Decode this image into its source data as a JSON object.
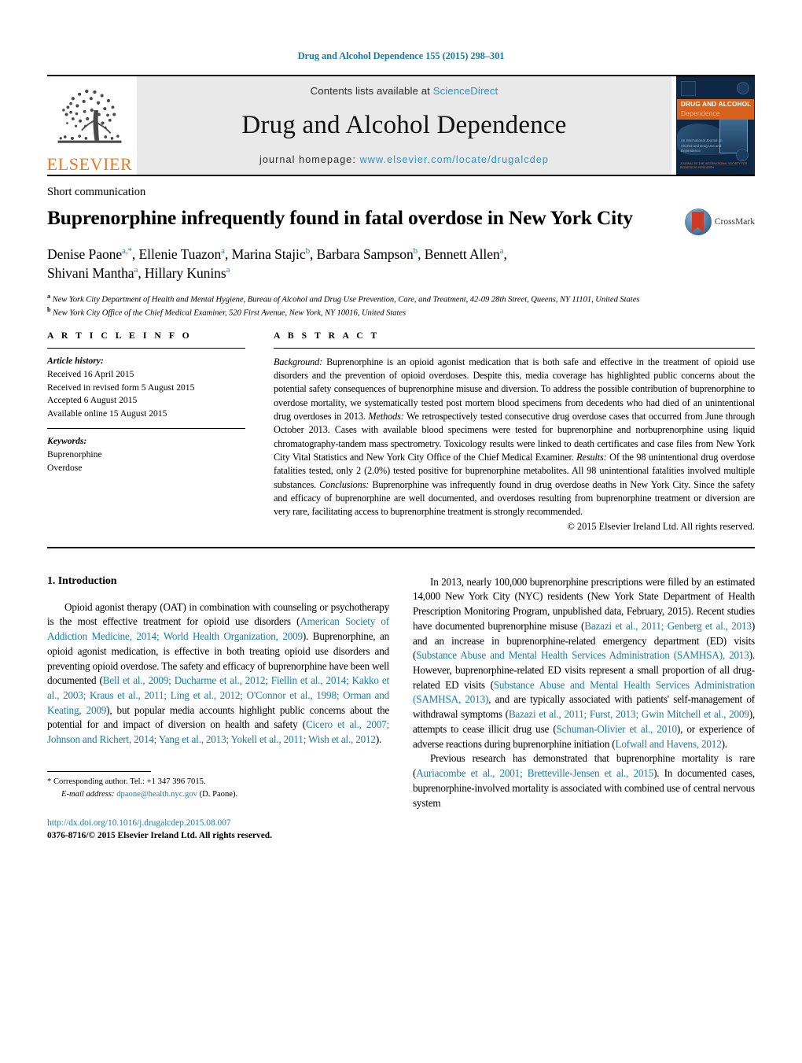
{
  "running_head": "Drug and Alcohol Dependence 155 (2015) 298–301",
  "banner": {
    "contents_prefix": "Contents lists available at ",
    "sciencedirect": "ScienceDirect",
    "journal_name": "Drug and Alcohol Dependence",
    "homepage_prefix": "journal homepage: ",
    "homepage_url": "www.elsevier.com/locate/drugalcdep",
    "publisher_wordmark": "ELSEVIER",
    "cover": {
      "title_line1": "DRUG AND ALCOHOL",
      "title_line2": "Dependence",
      "small_text": "An International Journal on Alcohol and Drug Use and Dependence",
      "bottom_text": "JOURNAL OF THE INTERNATIONAL SOCIETY FOR BIOMEDICAL RESEARCH"
    },
    "accent_orange": "#E87722",
    "accent_link": "#2b93c7"
  },
  "article": {
    "type": "Short communication",
    "title": "Buprenorphine infrequently found in fatal overdose in New York City",
    "crossmark_label": "CrossMark",
    "authors_line1_parts": [
      {
        "name": "Denise Paone",
        "sup": "a,*"
      },
      {
        "name": "Ellenie Tuazon",
        "sup": "a"
      },
      {
        "name": "Marina Stajic",
        "sup": "b"
      },
      {
        "name": "Barbara Sampson",
        "sup": "b"
      },
      {
        "name": "Bennett Allen",
        "sup": "a"
      }
    ],
    "authors_line2_parts": [
      {
        "name": "Shivani Mantha",
        "sup": "a"
      },
      {
        "name": "Hillary Kunins",
        "sup": "a"
      }
    ],
    "affiliation_a_marker": "a",
    "affiliation_a": "New York City Department of Health and Mental Hygiene, Bureau of Alcohol and Drug Use Prevention, Care, and Treatment, 42-09 28th Street, Queens, NY 11101, United States",
    "affiliation_b_marker": "b",
    "affiliation_b": "New York City Office of the Chief Medical Examiner, 520 First Avenue, New York, NY 10016, United States"
  },
  "article_info": {
    "heading": "A R T I C L E    I N F O",
    "history_label": "Article history:",
    "history": [
      "Received 16 April 2015",
      "Received in revised form 5 August 2015",
      "Accepted 6 August 2015",
      "Available online 15 August 2015"
    ],
    "keywords_label": "Keywords:",
    "keywords": [
      "Buprenorphine",
      "Overdose"
    ]
  },
  "abstract": {
    "heading": "A B S T R A C T",
    "sections": [
      {
        "label": "Background:",
        "text": " Buprenorphine is an opioid agonist medication that is both safe and effective in the treatment of opioid use disorders and the prevention of opioid overdoses. Despite this, media coverage has highlighted public concerns about the potential safety consequences of buprenorphine misuse and diversion. To address the possible contribution of buprenorphine to overdose mortality, we systematically tested post mortem blood specimens from decedents who had died of an unintentional drug overdoses in 2013."
      },
      {
        "label": "Methods:",
        "text": " We retrospectively tested consecutive drug overdose cases that occurred from June through October 2013. Cases with available blood specimens were tested for buprenorphine and norbuprenorphine using liquid chromatography-tandem mass spectrometry. Toxicology results were linked to death certificates and case files from New York City Vital Statistics and New York City Office of the Chief Medical Examiner."
      },
      {
        "label": "Results:",
        "text": " Of the 98 unintentional drug overdose fatalities tested, only 2 (2.0%) tested positive for buprenorphine metabolites. All 98 unintentional fatalities involved multiple substances."
      },
      {
        "label": "Conclusions:",
        "text": " Buprenorphine was infrequently found in drug overdose deaths in New York City. Since the safety and efficacy of buprenorphine are well documented, and overdoses resulting from buprenorphine treatment or diversion are very rare, facilitating access to buprenorphine treatment is strongly recommended."
      }
    ],
    "copyright": "© 2015 Elsevier Ireland Ltd. All rights reserved."
  },
  "body": {
    "section_heading": "1.  Introduction",
    "left_paragraphs": [
      [
        {
          "t": "Opioid agonist therapy (OAT) in combination with counseling or psychotherapy is the most effective treatment for opioid use disorders (",
          "link": false
        },
        {
          "t": "American Society of Addiction Medicine, 2014; World Health Organization, 2009",
          "link": true
        },
        {
          "t": "). Buprenorphine, an opioid agonist medication, is effective in both treating opioid use disorders and preventing opioid overdose. The safety and efficacy of buprenorphine have been well documented (",
          "link": false
        },
        {
          "t": "Bell et al., 2009; Ducharme et al., 2012; Fiellin et al., 2014; Kakko et al., 2003; Kraus et al., 2011; Ling et al., 2012; O'Connor et al., 1998; Orman and Keating, 2009",
          "link": true
        },
        {
          "t": "), but popular media accounts highlight public concerns about the potential for and impact of diversion on health and safety (",
          "link": false
        },
        {
          "t": "Cicero et al., 2007; Johnson and Richert, 2014; Yang et al., 2013; Yokell et al., 2011; Wish et al., 2012",
          "link": true
        },
        {
          "t": ").",
          "link": false
        }
      ]
    ],
    "right_paragraphs": [
      [
        {
          "t": "In 2013, nearly 100,000 buprenorphine prescriptions were filled by an estimated 14,000 New York City (NYC) residents (New York State Department of Health Prescription Monitoring Program, unpublished data, February, 2015). Recent studies have documented buprenorphine misuse (",
          "link": false
        },
        {
          "t": "Bazazi et al., 2011; Genberg et al., 2013",
          "link": true
        },
        {
          "t": ") and an increase in buprenorphine-related emergency department (ED) visits (",
          "link": false
        },
        {
          "t": "Substance Abuse and Mental Health Services Administration (SAMHSA), 2013",
          "link": true
        },
        {
          "t": "). However, buprenorphine-related ED visits represent a small proportion of all drug-related ED visits (",
          "link": false
        },
        {
          "t": "Substance Abuse and Mental Health Services Administration (SAMHSA, 2013)",
          "link": true
        },
        {
          "t": ", and are typically associated with patients' self-management of withdrawal symptoms (",
          "link": false
        },
        {
          "t": "Bazazi et al., 2011; Furst, 2013; Gwin Mitchell et al., 2009",
          "link": true
        },
        {
          "t": "), attempts to cease illicit drug use (",
          "link": false
        },
        {
          "t": "Schuman-Olivier et al., 2010",
          "link": true
        },
        {
          "t": "), or experience of adverse reactions during buprenorphine initiation (",
          "link": false
        },
        {
          "t": "Lofwall and Havens, 2012",
          "link": true
        },
        {
          "t": ").",
          "link": false
        }
      ],
      [
        {
          "t": "Previous research has demonstrated that buprenorphine mortality is rare (",
          "link": false
        },
        {
          "t": "Auriacombe et al., 2001; Bretteville-Jensen et al., 2015",
          "link": true
        },
        {
          "t": "). In documented cases, buprenorphine-involved mortality is associated with combined use of central nervous system",
          "link": false
        }
      ]
    ]
  },
  "footnotes": {
    "corresponding_marker": "*",
    "corresponding_text": " Corresponding author. Tel.: +1 347 396 7015.",
    "email_label": "E-mail address:",
    "email": "dpaone@health.nyc.gov",
    "email_suffix": " (D. Paone).",
    "doi_url": "http://dx.doi.org/10.1016/j.drugalcdep.2015.08.007",
    "issn_line": "0376-8716/© 2015 Elsevier Ireland Ltd. All rights reserved."
  }
}
